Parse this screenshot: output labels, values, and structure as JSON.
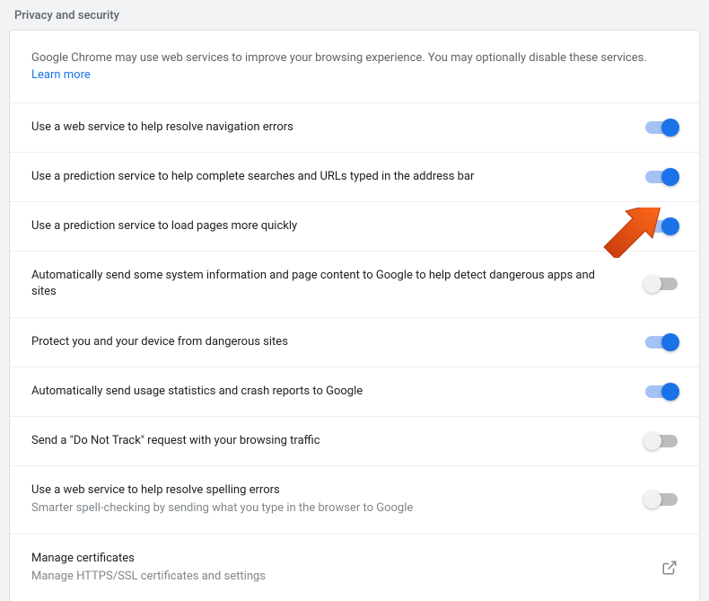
{
  "section_title": "Privacy and security",
  "intro": {
    "text": "Google Chrome may use web services to improve your browsing experience. You may optionally disable these services. ",
    "link_text": "Learn more"
  },
  "rows": [
    {
      "title": "Use a web service to help resolve navigation errors",
      "sub": "",
      "toggle": "on"
    },
    {
      "title": "Use a prediction service to help complete searches and URLs typed in the address bar",
      "sub": "",
      "toggle": "on"
    },
    {
      "title": "Use a prediction service to load pages more quickly",
      "sub": "",
      "toggle": "on"
    },
    {
      "title": "Automatically send some system information and page content to Google to help detect dangerous apps and sites",
      "sub": "",
      "toggle": "off"
    },
    {
      "title": "Protect you and your device from dangerous sites",
      "sub": "",
      "toggle": "on"
    },
    {
      "title": "Automatically send usage statistics and crash reports to Google",
      "sub": "",
      "toggle": "on"
    },
    {
      "title": "Send a \"Do Not Track\" request with your browsing traffic",
      "sub": "",
      "toggle": "off"
    },
    {
      "title": "Use a web service to help resolve spelling errors",
      "sub": "Smarter spell-checking by sending what you type in the browser to Google",
      "toggle": "off"
    },
    {
      "title": "Manage certificates",
      "sub": "Manage HTTPS/SSL certificates and settings",
      "action": "launch"
    }
  ],
  "arrow": {
    "row_index": 2
  }
}
